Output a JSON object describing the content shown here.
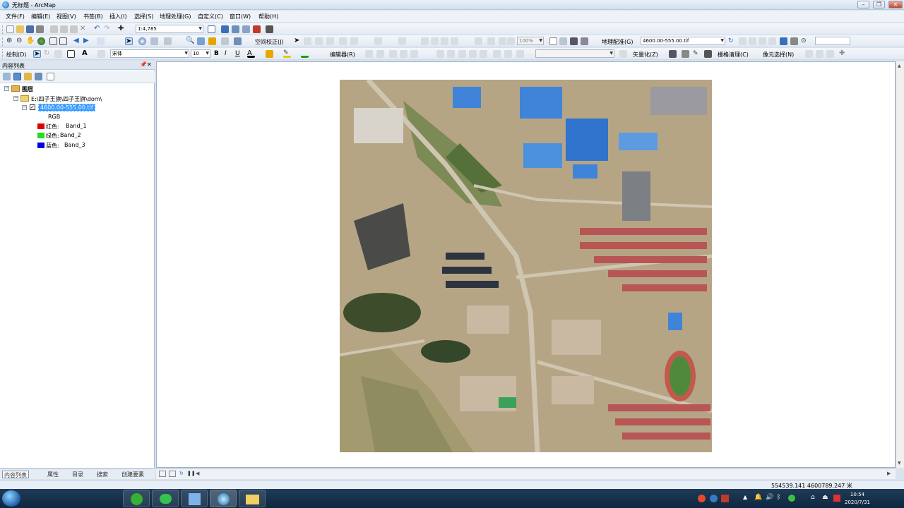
{
  "window": {
    "title": "无标题 - ArcMap",
    "controls": [
      "–",
      "❐",
      "✕"
    ]
  },
  "menubar": [
    "文件(F)",
    "编辑(E)",
    "视图(V)",
    "书签(B)",
    "插入(I)",
    "选择(S)",
    "地理处理(G)",
    "自定义(C)",
    "窗口(W)",
    "帮助(H)"
  ],
  "toolbar1": {
    "scale": "1:4,785"
  },
  "toolbar2": {
    "zoom": "100%",
    "spatial_adjust": "空间校正(J)",
    "georef_label": "地理配准(G)",
    "georef_layer": "4600.00-555.00.tif"
  },
  "toolbar3": {
    "draw": "绘制(D)",
    "font": "宋体",
    "font_size": "10",
    "editor": "编辑器(R)",
    "vectorize": "矢量化(Z)",
    "raster_cleanup": "栅格清理(C)",
    "cell_select": "像元选择(N)"
  },
  "toc": {
    "header": "内容列表",
    "layers_root": "图层",
    "folder": "E:\\四子王旗\\四子王旗\\dom\\",
    "layer": "4600.00-555.00.tif",
    "rgb_label": "RGB",
    "bands": [
      {
        "channel": "红色:",
        "band": "Band_1",
        "color": "#e00000"
      },
      {
        "channel": "绿色:",
        "band": "Band_2",
        "color": "#22dd22"
      },
      {
        "channel": "蓝色:",
        "band": "Band_3",
        "color": "#0000e0"
      }
    ],
    "tabs": [
      "内容列表",
      "属性",
      "目录",
      "搜索",
      "创建要素"
    ]
  },
  "status": {
    "coordinates": "554539.141  4600789.247 米"
  },
  "taskbar": {
    "time": "10:54",
    "date": "2020/7/31"
  },
  "colors": {
    "selection": "#3399ff",
    "taskbar": "#1f3b57"
  }
}
